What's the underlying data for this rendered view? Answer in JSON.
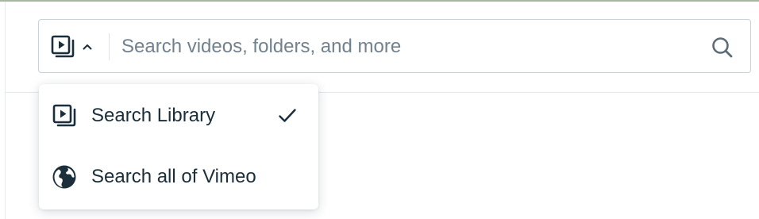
{
  "search": {
    "placeholder": "Search videos, folders, and more",
    "value": ""
  },
  "scope_dropdown": {
    "expanded": true,
    "items": [
      {
        "label": "Search Library",
        "icon": "video-library-icon",
        "selected": true
      },
      {
        "label": "Search all of Vimeo",
        "icon": "globe-icon",
        "selected": false
      }
    ]
  },
  "icons": {
    "toggle": "video-library-icon",
    "chevron": "chevron-up-icon",
    "search": "search-icon",
    "check": "checkmark-icon"
  },
  "colors": {
    "text": "#1a2e3b",
    "placeholder": "#71828e",
    "border": "#c9d2d8",
    "icon": "#1a2e3b"
  }
}
